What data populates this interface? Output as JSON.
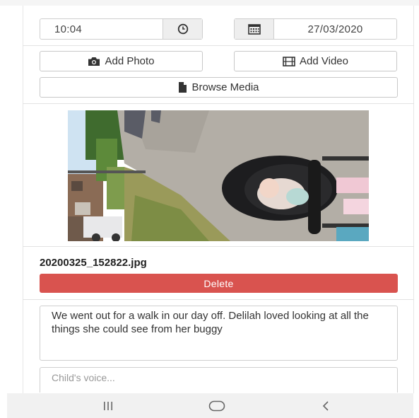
{
  "time": {
    "value": "10:04",
    "icon": "clock-icon"
  },
  "date": {
    "value": "27/03/2020",
    "icon": "calendar-icon"
  },
  "media_buttons": {
    "add_photo": "Add Photo",
    "add_video": "Add Video",
    "browse_media": "Browse Media"
  },
  "attachment": {
    "filename": "20200325_152822.jpg",
    "delete_label": "Delete"
  },
  "note": {
    "text": "We went out for a walk  in our day off. Delilah loved looking at all the things she could see from her buggy"
  },
  "childs_voice": {
    "placeholder": "Child's voice..."
  },
  "nav": {
    "recents": "|||",
    "home": "○",
    "back": "<"
  },
  "colors": {
    "danger": "#d9534f",
    "addon_bg": "#eeeeee",
    "border": "#cfcfcf"
  }
}
